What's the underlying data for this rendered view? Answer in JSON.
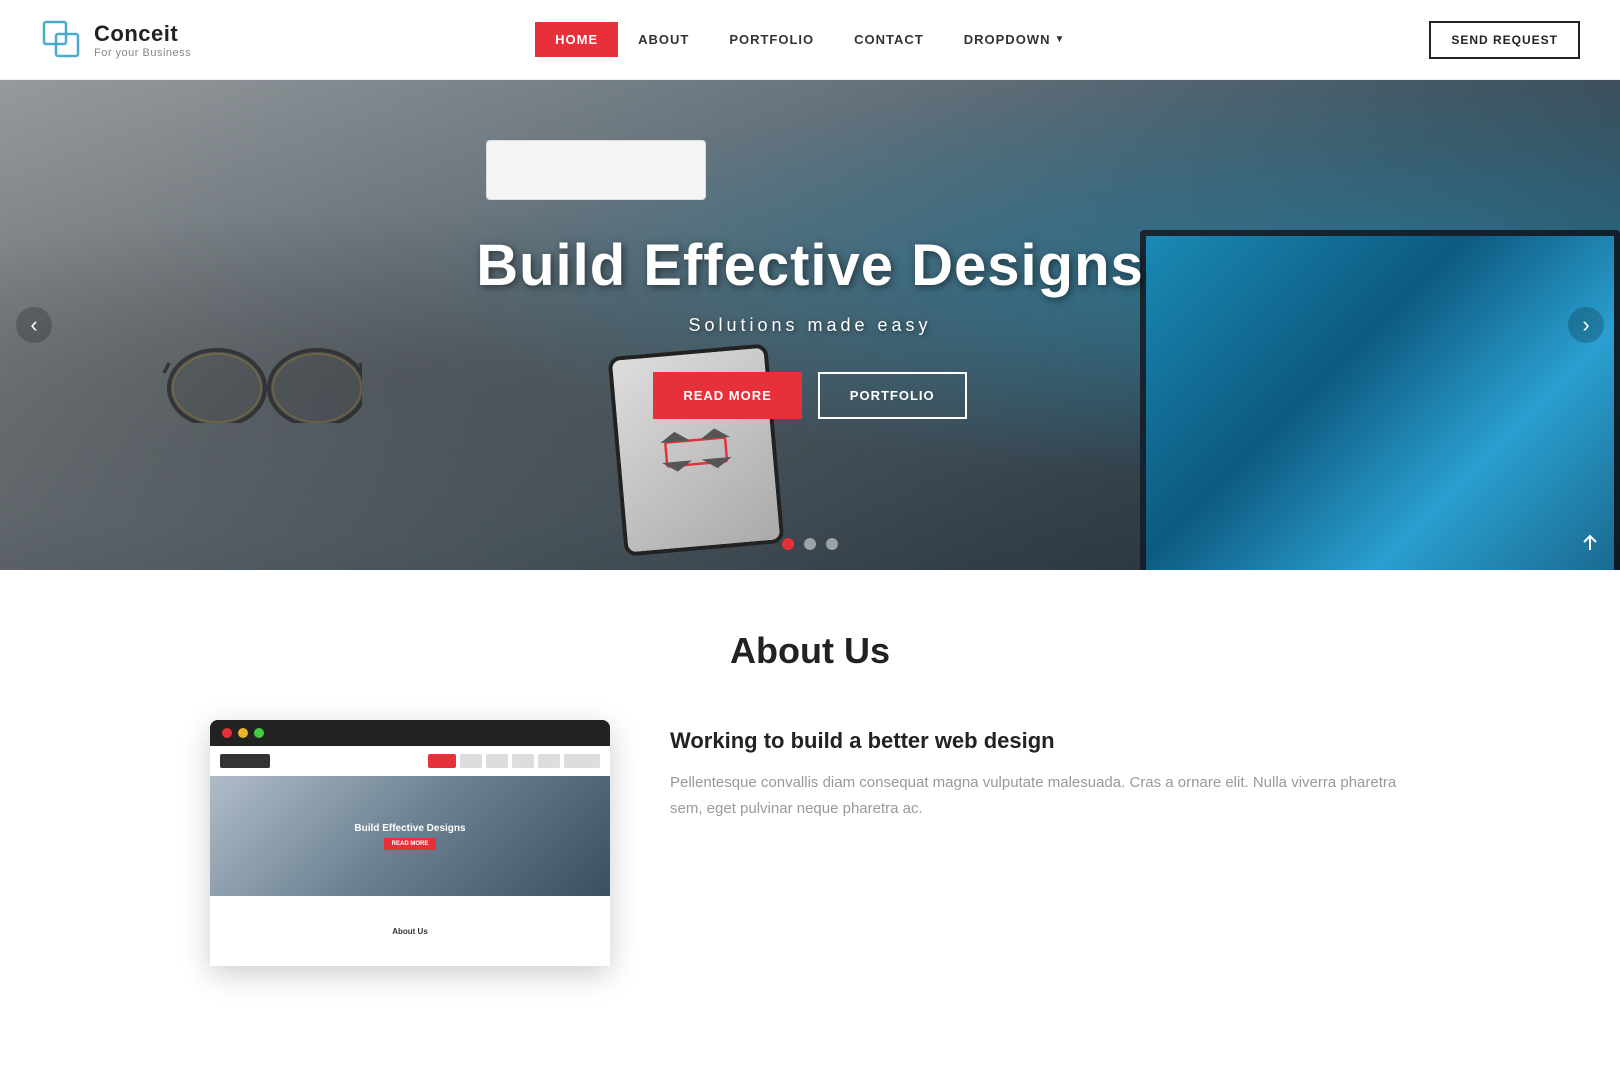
{
  "brand": {
    "name": "Conceit",
    "tagline": "For your Business"
  },
  "nav": {
    "links": [
      {
        "id": "home",
        "label": "HOME",
        "active": true
      },
      {
        "id": "about",
        "label": "ABOUT",
        "active": false
      },
      {
        "id": "portfolio",
        "label": "PORTFOLIO",
        "active": false
      },
      {
        "id": "contact",
        "label": "CONTACT",
        "active": false
      },
      {
        "id": "dropdown",
        "label": "DROPDOWN",
        "active": false,
        "hasArrow": true
      }
    ],
    "send_request": "SEND REQUEST"
  },
  "hero": {
    "title": "Build Effective Designs",
    "subtitle": "Solutions made easy",
    "btn_read_more": "READ MORE",
    "btn_portfolio": "PORTFOLIO",
    "dots": [
      {
        "active": true
      },
      {
        "active": false
      },
      {
        "active": false
      }
    ]
  },
  "about": {
    "section_title": "About Us",
    "mockup": {
      "hero_text": "Build Effective Designs"
    },
    "content_title": "Working to build a better web design",
    "content_body": "Pellentesque convallis diam consequat magna vulputate malesuada. Cras a ornare elit. Nulla viverra pharetra sem, eget pulvinar neque pharetra ac."
  }
}
